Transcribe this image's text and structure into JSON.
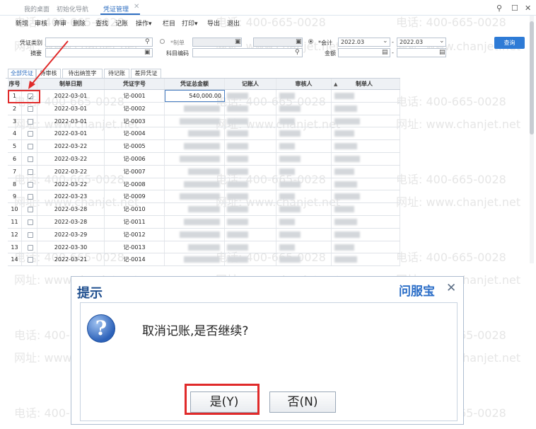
{
  "tabs": [
    {
      "label": "我的桌面"
    },
    {
      "label": "初始化导航"
    },
    {
      "label": "凭证管理",
      "active": true
    }
  ],
  "toolbar": [
    "新增",
    "审核",
    "弃审",
    "删除",
    "查找",
    "记账",
    "操作▾",
    "栏目",
    "打印▾",
    "导出",
    "退出"
  ],
  "filters": {
    "voucher_type_label": "凭证类别",
    "summary_label": "摘要",
    "create_date_label": "*制单",
    "subject_code_label": "科目编码",
    "period_label": "*会计",
    "period_from": "2022.03",
    "period_to": "2022.03",
    "amount_label": "金额",
    "query_button": "查询"
  },
  "subtabs": [
    "全部凭证",
    "待审核",
    "待出纳签字",
    "待记账",
    "差异凭证"
  ],
  "grid": {
    "columns": {
      "idx": "序号",
      "date": "制单日期",
      "no": "凭证字号",
      "amount": "凭证总金额",
      "recorder": "记账人",
      "auditor": "审核人",
      "maker": "制单人"
    },
    "rows": [
      {
        "idx": "1",
        "date": "2022-03-01",
        "no": "记-0001",
        "amount": "540,000.00",
        "checked": true
      },
      {
        "idx": "2",
        "date": "2022-03-01",
        "no": "记-0002"
      },
      {
        "idx": "3",
        "date": "2022-03-01",
        "no": "记-0003"
      },
      {
        "idx": "4",
        "date": "2022-03-01",
        "no": "记-0004"
      },
      {
        "idx": "5",
        "date": "2022-03-22",
        "no": "记-0005"
      },
      {
        "idx": "6",
        "date": "2022-03-22",
        "no": "记-0006"
      },
      {
        "idx": "7",
        "date": "2022-03-22",
        "no": "记-0007"
      },
      {
        "idx": "8",
        "date": "2022-03-22",
        "no": "记-0008"
      },
      {
        "idx": "9",
        "date": "2022-03-23",
        "no": "记-0009"
      },
      {
        "idx": "10",
        "date": "2022-03-28",
        "no": "记-0010"
      },
      {
        "idx": "11",
        "date": "2022-03-28",
        "no": "记-0011"
      },
      {
        "idx": "12",
        "date": "2022-03-29",
        "no": "记-0012"
      },
      {
        "idx": "13",
        "date": "2022-03-30",
        "no": "记-0013"
      },
      {
        "idx": "14",
        "date": "2022-03-21",
        "no": "记-0014"
      }
    ]
  },
  "dialog": {
    "title": "提示",
    "brand": "问服宝",
    "message": "取消记账,是否继续?",
    "yes": "是(Y)",
    "no": "否(N)"
  },
  "watermark": {
    "phone": "电话: 400-665-0028",
    "site": "网址: www.chanjet.net"
  },
  "colors": {
    "accent": "#2e7bd6",
    "annotation": "#e02a2a"
  }
}
